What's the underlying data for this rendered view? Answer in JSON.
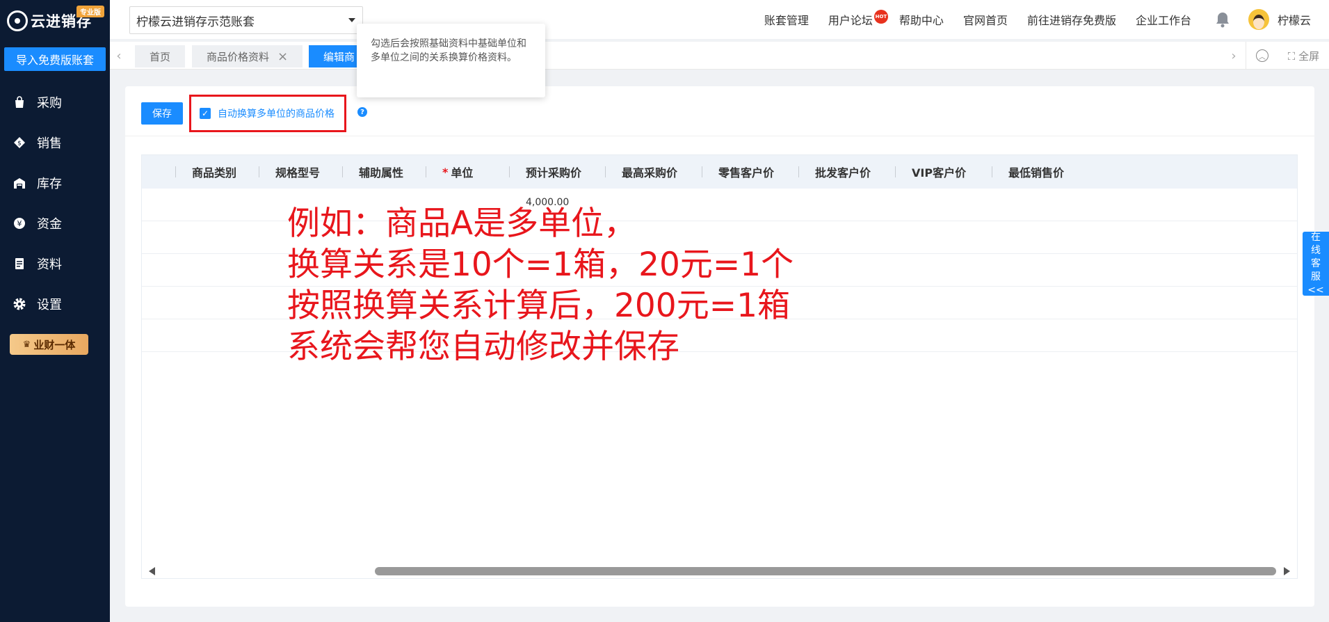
{
  "sidebar": {
    "logo_text": "云进销存",
    "pro_badge": "专业版",
    "import_button": "导入免费版账套",
    "items": [
      {
        "label": "采购",
        "icon": "shopping-bag-icon"
      },
      {
        "label": "销售",
        "icon": "dollar-tag-icon"
      },
      {
        "label": "库存",
        "icon": "warehouse-icon"
      },
      {
        "label": "资金",
        "icon": "yen-coin-icon"
      },
      {
        "label": "资料",
        "icon": "document-icon"
      },
      {
        "label": "设置",
        "icon": "gear-icon"
      }
    ],
    "yecai_label": "业财一体"
  },
  "header": {
    "account_select": "柠檬云进销存示范账套",
    "links": [
      "账套管理",
      "用户论坛",
      "帮助中心",
      "官网首页",
      "前往进销存免费版",
      "企业工作台"
    ],
    "hot_badge": "HOT",
    "user_name": "柠檬云"
  },
  "tabs": {
    "items": [
      "首页",
      "商品价格资料",
      "编辑商"
    ],
    "fullscreen": "全屏"
  },
  "tooltip": {
    "text": "勾选后会按照基础资料中基础单位和多单位之间的关系换算价格资料。"
  },
  "toolbar": {
    "save_label": "保存",
    "checkbox_label": "自动换算多单位的商品价格",
    "checkbox_checked": true
  },
  "table": {
    "columns": [
      "商品类别",
      "规格型号",
      "辅助属性",
      "单位",
      "预计采购价",
      "最高采购价",
      "零售客户价",
      "批发客户价",
      "VIP客户价",
      "最低销售价"
    ],
    "required_column": "单位",
    "rows": [
      {
        "预计采购价": "4,000.00"
      },
      {},
      {},
      {},
      {}
    ]
  },
  "annotation": {
    "lines": [
      "例如：商品A是多单位，",
      "换算关系是10个=1箱，20元=1个",
      "按照换算关系计算后，200元=1箱",
      "系统会帮您自动修改并保存"
    ]
  },
  "service": {
    "chars": [
      "在",
      "线",
      "客",
      "服",
      "<<"
    ]
  },
  "colors": {
    "sidebar_bg": "#0c1b33",
    "accent": "#1a8cff",
    "annotation_red": "#e8161c"
  }
}
